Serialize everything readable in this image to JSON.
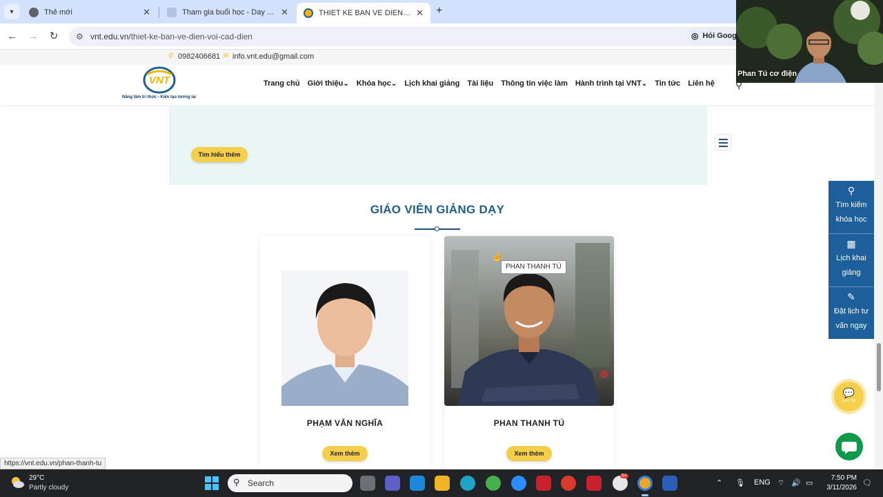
{
  "browser": {
    "tabs": [
      {
        "label": "Thẻ mới",
        "active": false
      },
      {
        "label": "Tham gia buổi học - Day Mãi",
        "active": false
      },
      {
        "label": "THIET KE BAN VE DIEN VOI CAD",
        "active": true
      }
    ],
    "close_glyph": "✕",
    "new_tab_glyph": "+",
    "url_host": "vnt.edu.vn",
    "url_path": "/thiet-ke-ban-ve-dien-voi-cad-dien",
    "ask_google_label": "Hỏi Googl"
  },
  "site": {
    "phone": "0982406681",
    "email": "info.vnt.edu@gmail.com",
    "logo_text": "VNT",
    "logo_tagline": "Nâng tầm tri thức - Kiến tạo tương lai",
    "nav": [
      {
        "label": "Trang chủ",
        "dropdown": false
      },
      {
        "label": "Giới thiệu",
        "dropdown": true
      },
      {
        "label": "Khóa học",
        "dropdown": true
      },
      {
        "label": "Lịch khai giảng",
        "dropdown": false
      },
      {
        "label": "Tài liệu",
        "dropdown": false
      },
      {
        "label": "Thông tin việc làm",
        "dropdown": false
      },
      {
        "label": "Hành trình tại VNT",
        "dropdown": true
      },
      {
        "label": "Tin tức",
        "dropdown": false
      },
      {
        "label": "Liên hệ",
        "dropdown": false
      }
    ],
    "promo_button": "Tìm hiểu thêm",
    "section_title": "GIÁO VIÊN GIẢNG DẠY",
    "teachers": [
      {
        "name": "PHẠM VĂN NGHĨA",
        "button": "Xem thêm"
      },
      {
        "name": "PHAN THANH TÚ",
        "button": "Xem thêm"
      }
    ],
    "tooltip": "PHAN THANH TÚ",
    "side_panel": [
      {
        "label_line1": "Tìm kiếm",
        "label_line2": "khóa học",
        "icon": "search-icon"
      },
      {
        "label_line1": "Lịch khai",
        "label_line2": "giảng",
        "icon": "calendar-icon"
      },
      {
        "label_line1": "Đặt lịch tư",
        "label_line2": "vấn ngay",
        "icon": "edit-icon"
      }
    ],
    "contact_bubble_label": "Liên hệ",
    "status_url": "https://vnt.edu.vn/phan-thanh-tu"
  },
  "webcam": {
    "name": "Phan Tú cơ điện"
  },
  "taskbar": {
    "temperature": "29°C",
    "weather": "Partly cloudy",
    "search_placeholder": "Search",
    "language": "ENG",
    "time": "7:50 PM",
    "date": "3/11/2026",
    "notification_badge": "5+"
  },
  "colors": {
    "accent_yellow": "#f6cf4a",
    "title_blue": "#1e5f8e",
    "side_panel_blue": "#1d5f9a",
    "chat_green": "#0e9a4a"
  }
}
